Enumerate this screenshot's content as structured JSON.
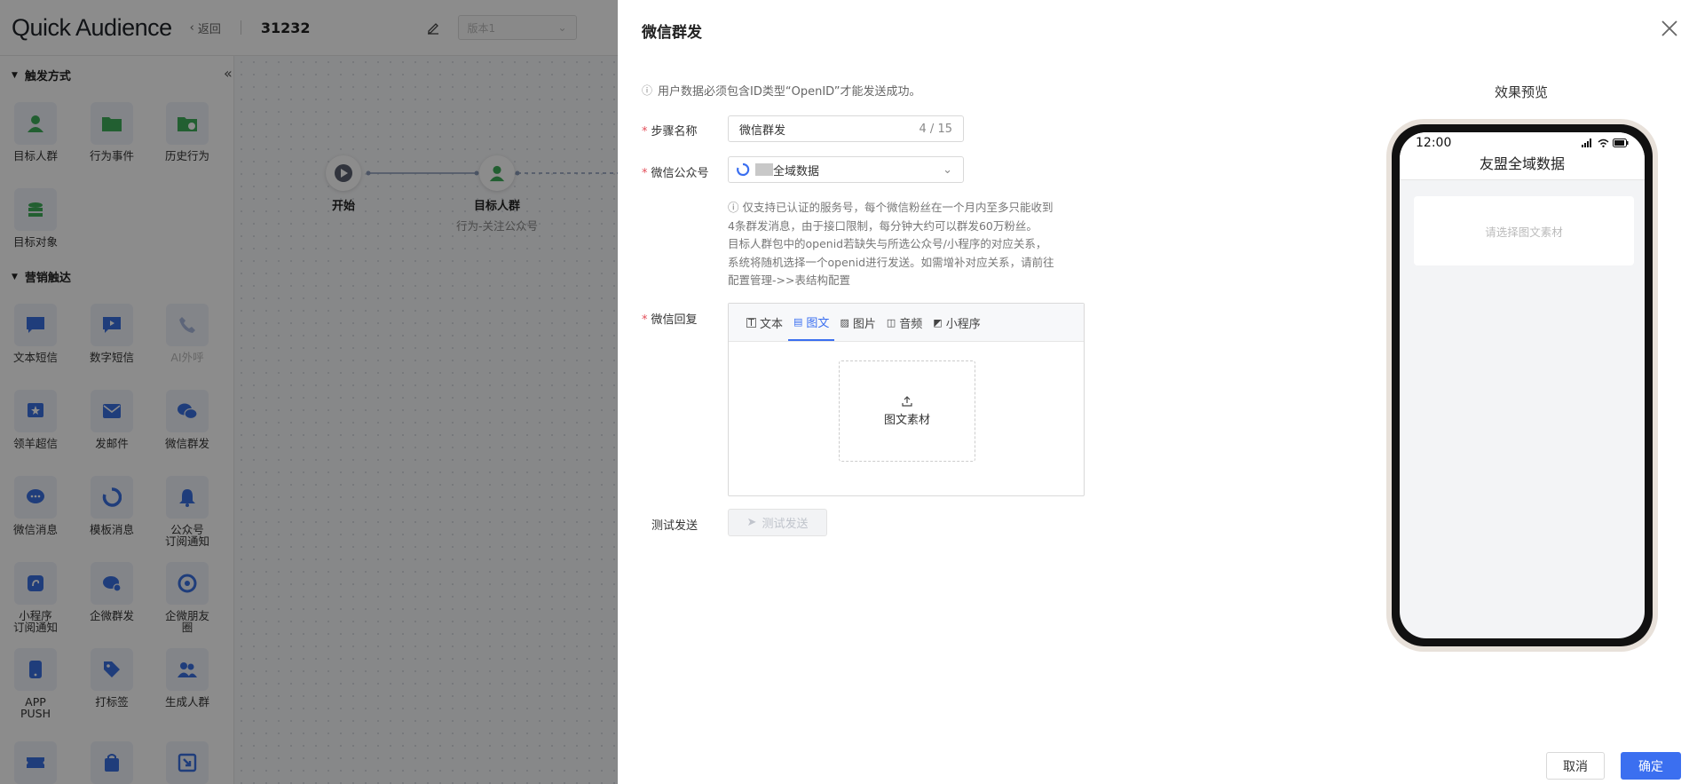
{
  "header": {
    "logo": "Quick Audience",
    "back_label": "返回",
    "journey_id": "31232",
    "version_placeholder": "版本1"
  },
  "sidebar": {
    "section_trigger": "触发方式",
    "section_marketing": "营销触达",
    "trigger_items": [
      {
        "label": "目标人群",
        "icon": "user-icon"
      },
      {
        "label": "行为事件",
        "icon": "folder-icon"
      },
      {
        "label": "历史行为",
        "icon": "folder-clock-icon"
      },
      {
        "label": "目标对象",
        "icon": "coins-icon"
      }
    ],
    "marketing_items": [
      {
        "label": "文本短信",
        "icon": "sms-icon"
      },
      {
        "label": "数字短信",
        "icon": "video-message-icon"
      },
      {
        "label": "AI外呼",
        "icon": "phone-icon"
      },
      {
        "label": "领羊超信",
        "icon": "star-message-icon"
      },
      {
        "label": "发邮件",
        "icon": "mail-icon"
      },
      {
        "label": "微信群发",
        "icon": "wechat-icon"
      },
      {
        "label": "微信消息",
        "icon": "chat-bubble-icon"
      },
      {
        "label": "模板消息",
        "icon": "refresh-icon"
      },
      {
        "label": "公众号\n订阅通知",
        "icon": "bell-icon"
      },
      {
        "label": "小程序\n订阅通知",
        "icon": "miniprogram-icon"
      },
      {
        "label": "企微群发",
        "icon": "wecom-group-icon"
      },
      {
        "label": "企微朋友\n圈",
        "icon": "moments-icon"
      },
      {
        "label": "APP\nPUSH",
        "icon": "mobile-icon"
      },
      {
        "label": "打标签",
        "icon": "tag-icon"
      },
      {
        "label": "生成人群",
        "icon": "group-icon"
      }
    ]
  },
  "canvas": {
    "start_label": "开始",
    "node_title": "目标人群",
    "node_subtitle": "行为-关注公众号"
  },
  "drawer": {
    "title": "微信群发",
    "hint": "用户数据必须包含ID类型“OpenID”才能发送成功。",
    "step_name_label": "步骤名称",
    "step_name_value": "微信群发",
    "step_name_count": "4 / 15",
    "account_label": "微信公众号",
    "account_value": "全域数据",
    "description_lines": [
      "ⓘ 仅支持已认证的服务号，每个微信粉丝在一个月内至多只能收到",
      "4条群发消息，由于接口限制，每分钟大约可以群发60万粉丝。",
      "目标人群包中的openid若缺失与所选公众号/小程序的对应关系，",
      "系统将随机选择一个openid进行发送。如需增补对应关系，请前往",
      "配置管理->>表结构配置"
    ],
    "reply_label": "微信回复",
    "tabs": [
      {
        "label": "文本",
        "icon": "text-icon"
      },
      {
        "label": "图文",
        "icon": "image-text-icon"
      },
      {
        "label": "图片",
        "icon": "image-icon"
      },
      {
        "label": "音频",
        "icon": "audio-icon"
      },
      {
        "label": "小程序",
        "icon": "miniprogram-icon"
      }
    ],
    "active_tab": "图文",
    "upload_label": "图文素材",
    "test_label": "测试发送",
    "test_button": "测试发送",
    "preview_title": "效果预览",
    "phone_time": "12:00",
    "phone_chat_title": "友盟全域数据",
    "phone_empty": "请选择图文素材",
    "cancel": "取消",
    "confirm": "确定"
  },
  "colors": {
    "accent": "#3b6ff0",
    "green": "#3fae5a",
    "required": "#e34d59"
  }
}
